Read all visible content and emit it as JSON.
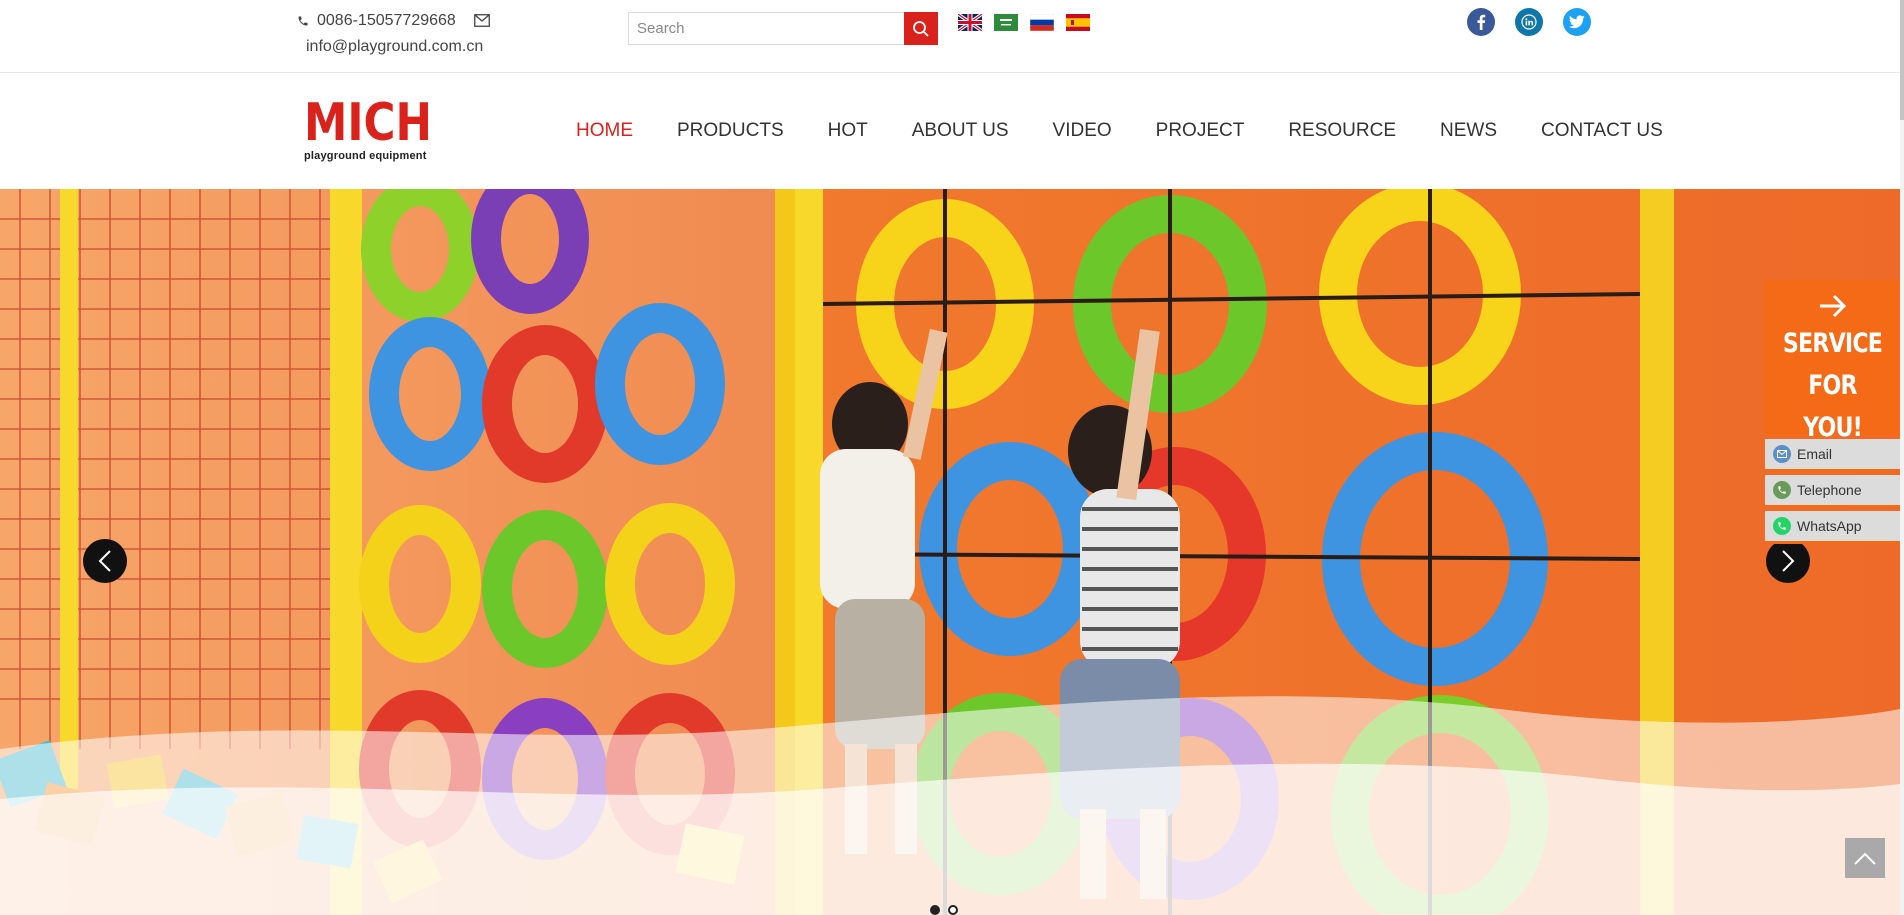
{
  "topbar": {
    "phone": "0086-15057729668",
    "email": "info@playground.com.cn",
    "search_placeholder": "Search",
    "languages": [
      "english-flag",
      "arabic-flag",
      "russian-flag",
      "spanish-flag"
    ],
    "socials": [
      "facebook-icon",
      "linkedin-icon",
      "twitter-icon"
    ]
  },
  "header": {
    "logo_text": "MICH",
    "logo_sub": "playground equipment",
    "nav": [
      "HOME",
      "PRODUCTS",
      "HOT",
      "ABOUT US",
      "VIDEO",
      "PROJECT",
      "RESOURCE",
      "NEWS",
      "CONTACT US"
    ],
    "active_nav": "HOME"
  },
  "service_panel": {
    "title_line1": "SERVICE",
    "title_line2": "FOR YOU!",
    "items": [
      "Email",
      "Telephone",
      "WhatsApp"
    ]
  },
  "slider": {
    "slide_count": 2,
    "active_slide": 1
  },
  "colors": {
    "accent": "#d9221c",
    "service_orange": "#f46a16",
    "facebook": "#3b5998",
    "linkedin": "#0e76a8",
    "twitter": "#1da1f2"
  }
}
